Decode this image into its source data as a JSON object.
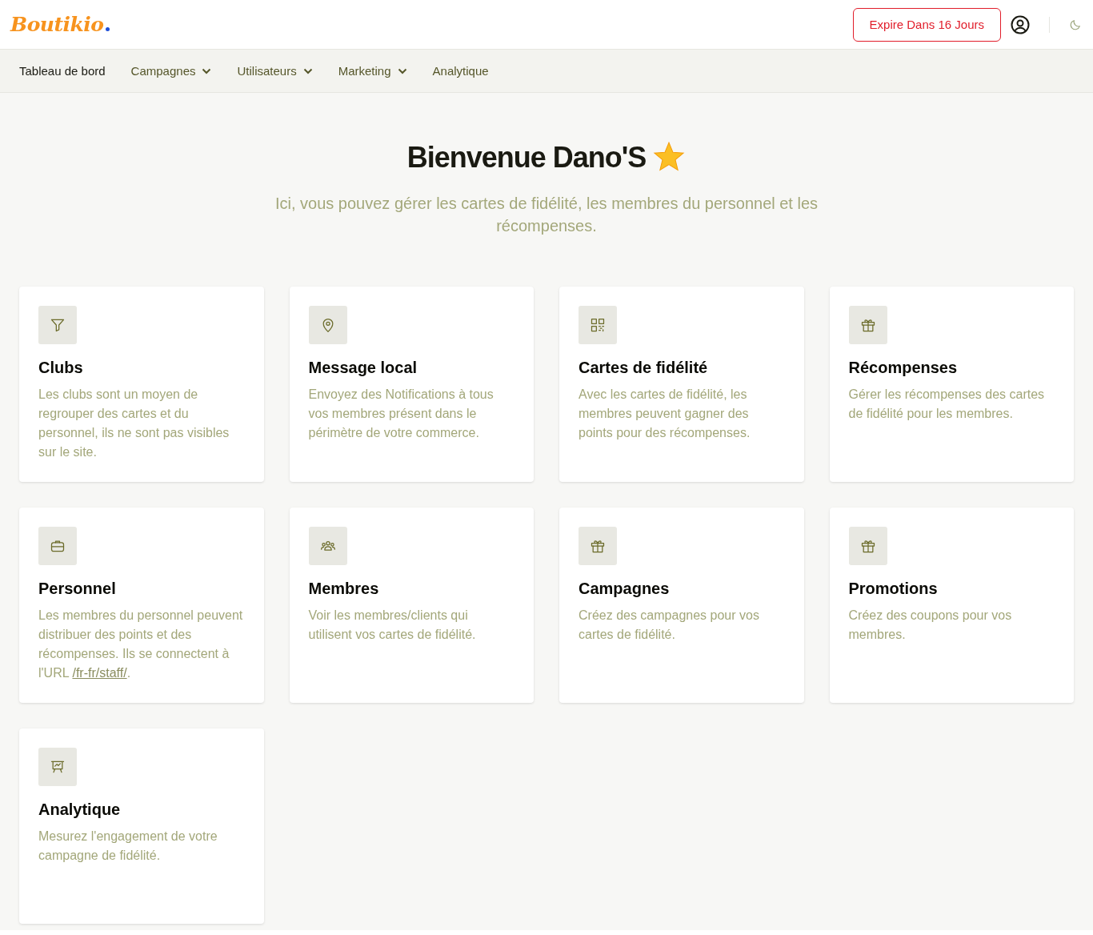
{
  "header": {
    "logo": "Boutikio",
    "expiry_button": "Expire Dans 16 Jours"
  },
  "nav": [
    {
      "label": "Tableau de bord",
      "selected": true,
      "has_menu": false
    },
    {
      "label": "Campagnes",
      "selected": false,
      "has_menu": true
    },
    {
      "label": "Utilisateurs",
      "selected": false,
      "has_menu": true
    },
    {
      "label": "Marketing",
      "selected": false,
      "has_menu": true
    },
    {
      "label": "Analytique",
      "selected": false,
      "has_menu": false
    }
  ],
  "welcome": {
    "title": "Bienvenue Dano'S",
    "subtitle": "Ici, vous pouvez gérer les cartes de fidélité, les membres du personnel et les récompenses."
  },
  "cards": [
    {
      "title": "Clubs",
      "description": "Les clubs sont un moyen de regrouper des cartes et du personnel, ils ne sont pas visibles sur le site."
    },
    {
      "title": "Message local",
      "description": "Envoyez des Notifications à tous vos membres présent dans le périmètre de votre commerce."
    },
    {
      "title": "Cartes de fidélité",
      "description": "Avec les cartes de fidélité, les membres peuvent gagner des points pour des récompenses."
    },
    {
      "title": "Récompenses",
      "description": "Gérer les récompenses des cartes de fidélité pour les membres."
    },
    {
      "title": "Personnel",
      "description": "Les membres du personnel peuvent distribuer des points et des récompenses. Ils se connectent à l'URL ",
      "link": "/fr-fr/staff/",
      "description_end": "."
    },
    {
      "title": "Membres",
      "description": "Voir les membres/clients qui utilisent vos cartes de fidélité."
    },
    {
      "title": "Campagnes",
      "description": "Créez des campagnes pour vos cartes de fidélité."
    },
    {
      "title": "Promotions",
      "description": "Créez des coupons pour vos membres."
    },
    {
      "title": "Analytique",
      "description": "Mesurez l'engagement de votre campagne de fidélité."
    }
  ]
}
